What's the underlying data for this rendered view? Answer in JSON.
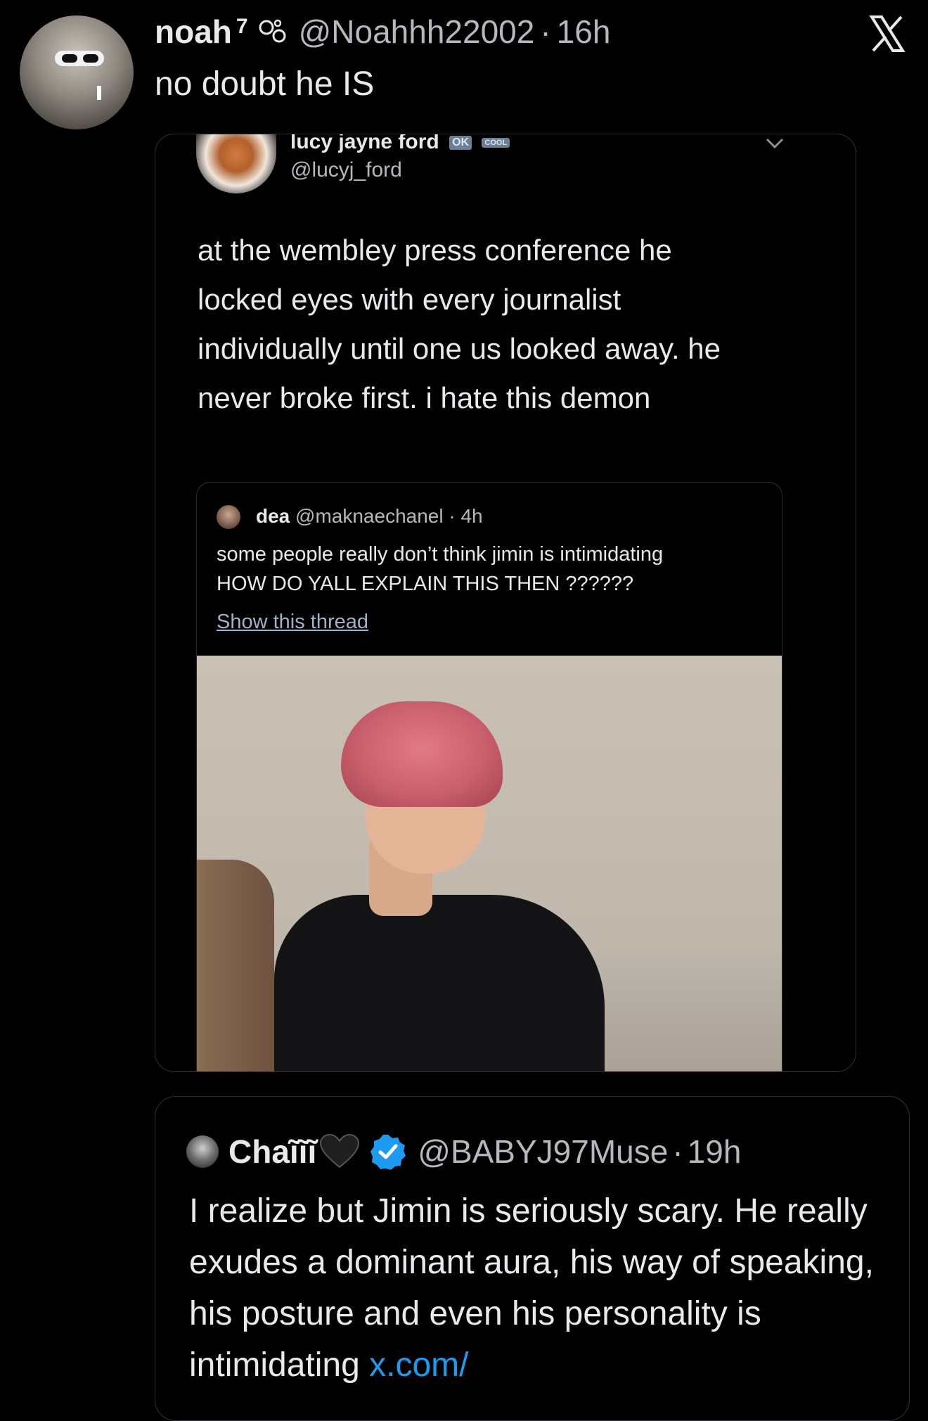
{
  "top_tweet": {
    "display_name": "noah",
    "name_superscript": "7",
    "handle": "@Noahhh22002",
    "separator": "·",
    "time": "16h",
    "text": "no doubt he IS",
    "avatar_icon": "profile-photo-sunglasses",
    "logo_icon": "x-logo"
  },
  "quote_card": {
    "author_name": "lucy jayne ford",
    "badge_1": "OK",
    "badge_2": "COOL",
    "handle": "@lucyj_ford",
    "text_lines": [
      "at the wembley press conference he",
      "locked eyes with every journalist",
      "individually until one us looked away. he",
      "never broke first. i hate this demon"
    ],
    "nested_tweet": {
      "author_name": "dea",
      "handle": "@maknaechanel",
      "separator": "·",
      "time": "4h",
      "line_1": "some people really don’t think jimin is intimidating",
      "line_2": "HOW DO YALL EXPLAIN THIS THEN ??????",
      "show_thread": "Show this thread"
    }
  },
  "quote_card_2": {
    "author_name": "Chaĩĩĩ",
    "heart_emoji": "black-heart",
    "verified_icon": "verified-badge",
    "handle": "@BABYJ97Muse",
    "separator": "·",
    "time": "19h",
    "text": "I realize but Jimin is seriously scary. He really exudes a dominant aura, his way of speaking, his posture and even his personality is intimidating ",
    "link": "x.com/"
  },
  "colors": {
    "background": "#000000",
    "text_primary": "#e7e9ea",
    "text_secondary": "#b4b9bd",
    "link": "#1d9bf0",
    "verified": "#1d9bf0"
  }
}
